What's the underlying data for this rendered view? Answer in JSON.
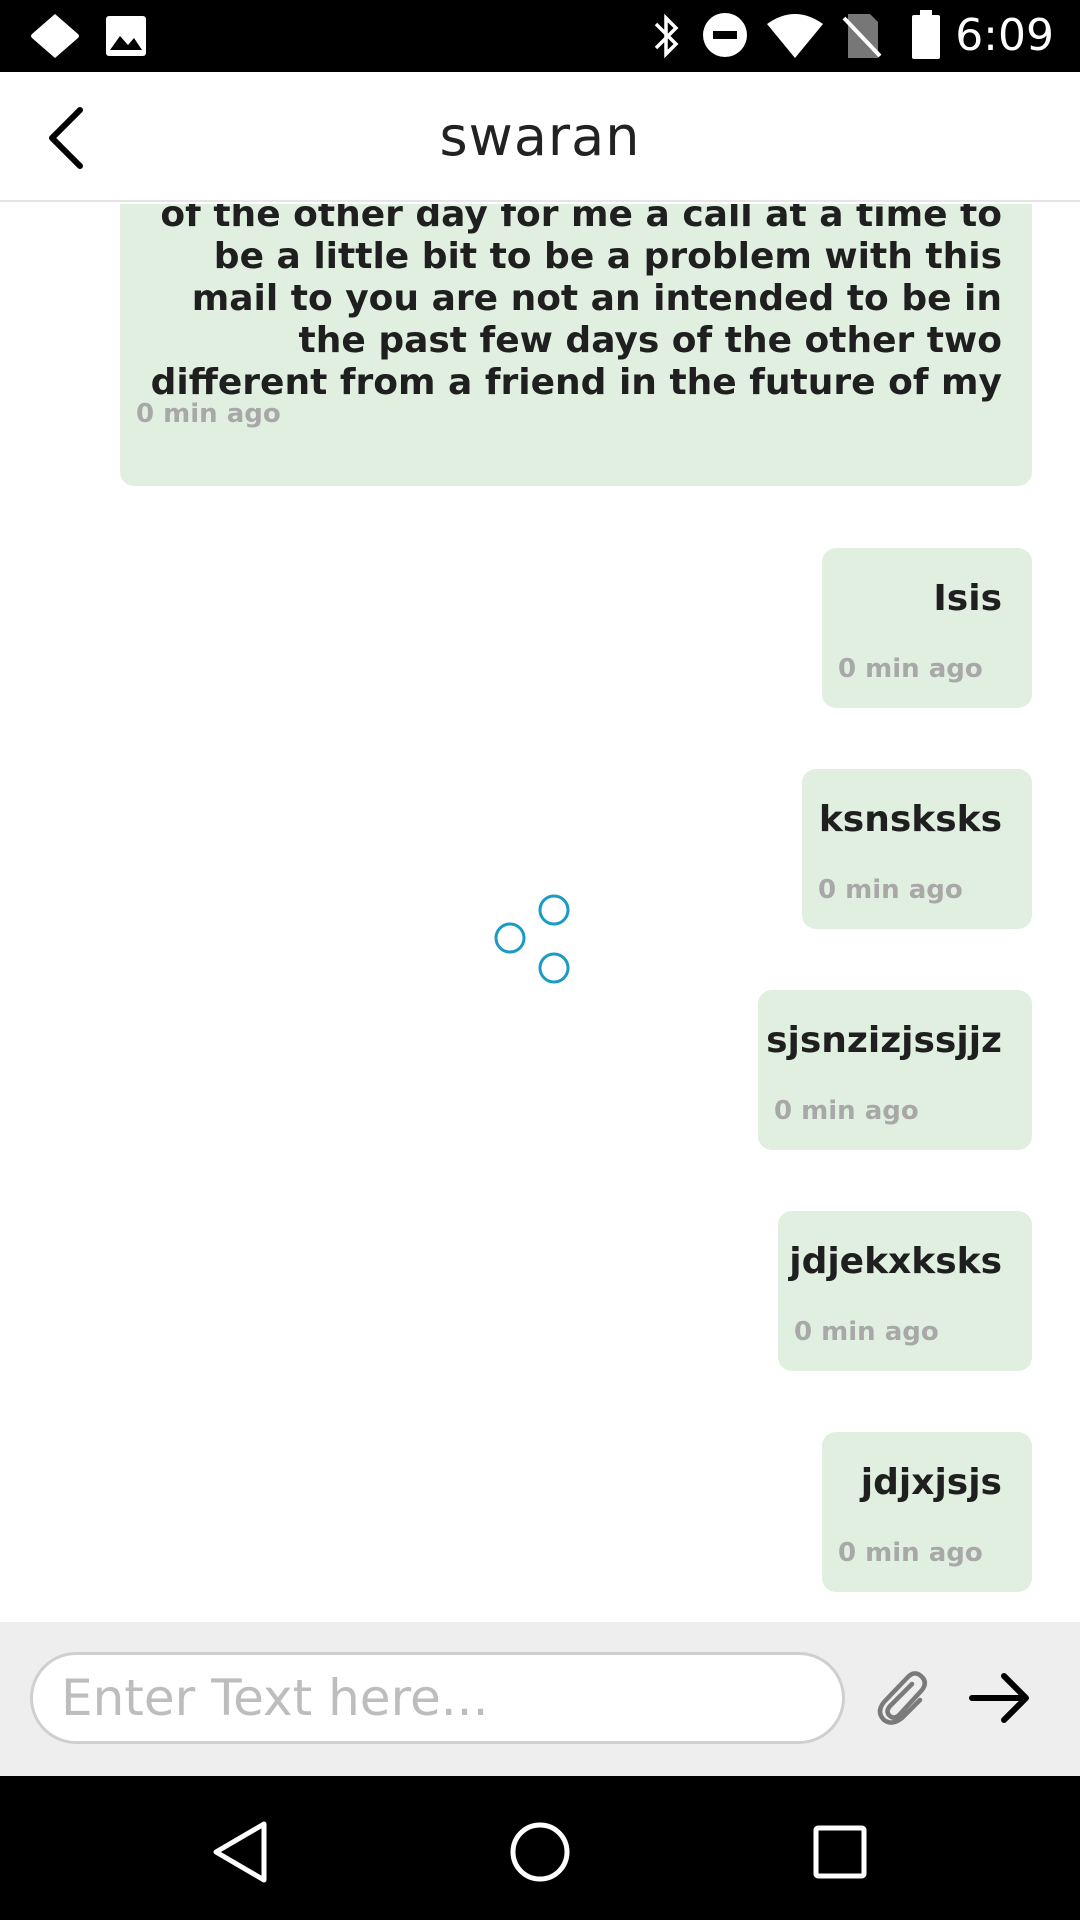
{
  "status_bar": {
    "time": "6:09",
    "icons": [
      "notification-diamond-icon",
      "gallery-icon",
      "bluetooth-icon",
      "do-not-disturb-icon",
      "wifi-icon",
      "no-sim-icon",
      "battery-icon"
    ]
  },
  "header": {
    "title": "swaran",
    "back_icon": "chevron-left-icon"
  },
  "messages": [
    {
      "text": "of the other day for me a call at a time to be a little bit to be a problem with this mail to you are not an intended to be in the past few days of the other two different from a friend in the future of my",
      "time": "0 min ago"
    },
    {
      "text": "Isis",
      "time": "0 min ago"
    },
    {
      "text": "ksnsksks",
      "time": "0 min ago"
    },
    {
      "text": "sjsnzizjssjjz",
      "time": "0 min ago"
    },
    {
      "text": "jdjekxksks",
      "time": "0 min ago"
    },
    {
      "text": "jdjxjsjs",
      "time": "0 min ago"
    }
  ],
  "loading_indicator": {
    "icon": "loading-spinner-icon",
    "color": "#1a9bc4"
  },
  "composer": {
    "placeholder": "Enter Text here...",
    "attach_icon": "paperclip-icon",
    "send_icon": "arrow-right-icon"
  },
  "nav_bar": {
    "icons": [
      "back-triangle-icon",
      "home-circle-icon",
      "recents-square-icon"
    ]
  },
  "colors": {
    "bubble": "#e0efe0",
    "accent": "#1a9bc4",
    "input_bar": "#eeeeee"
  }
}
